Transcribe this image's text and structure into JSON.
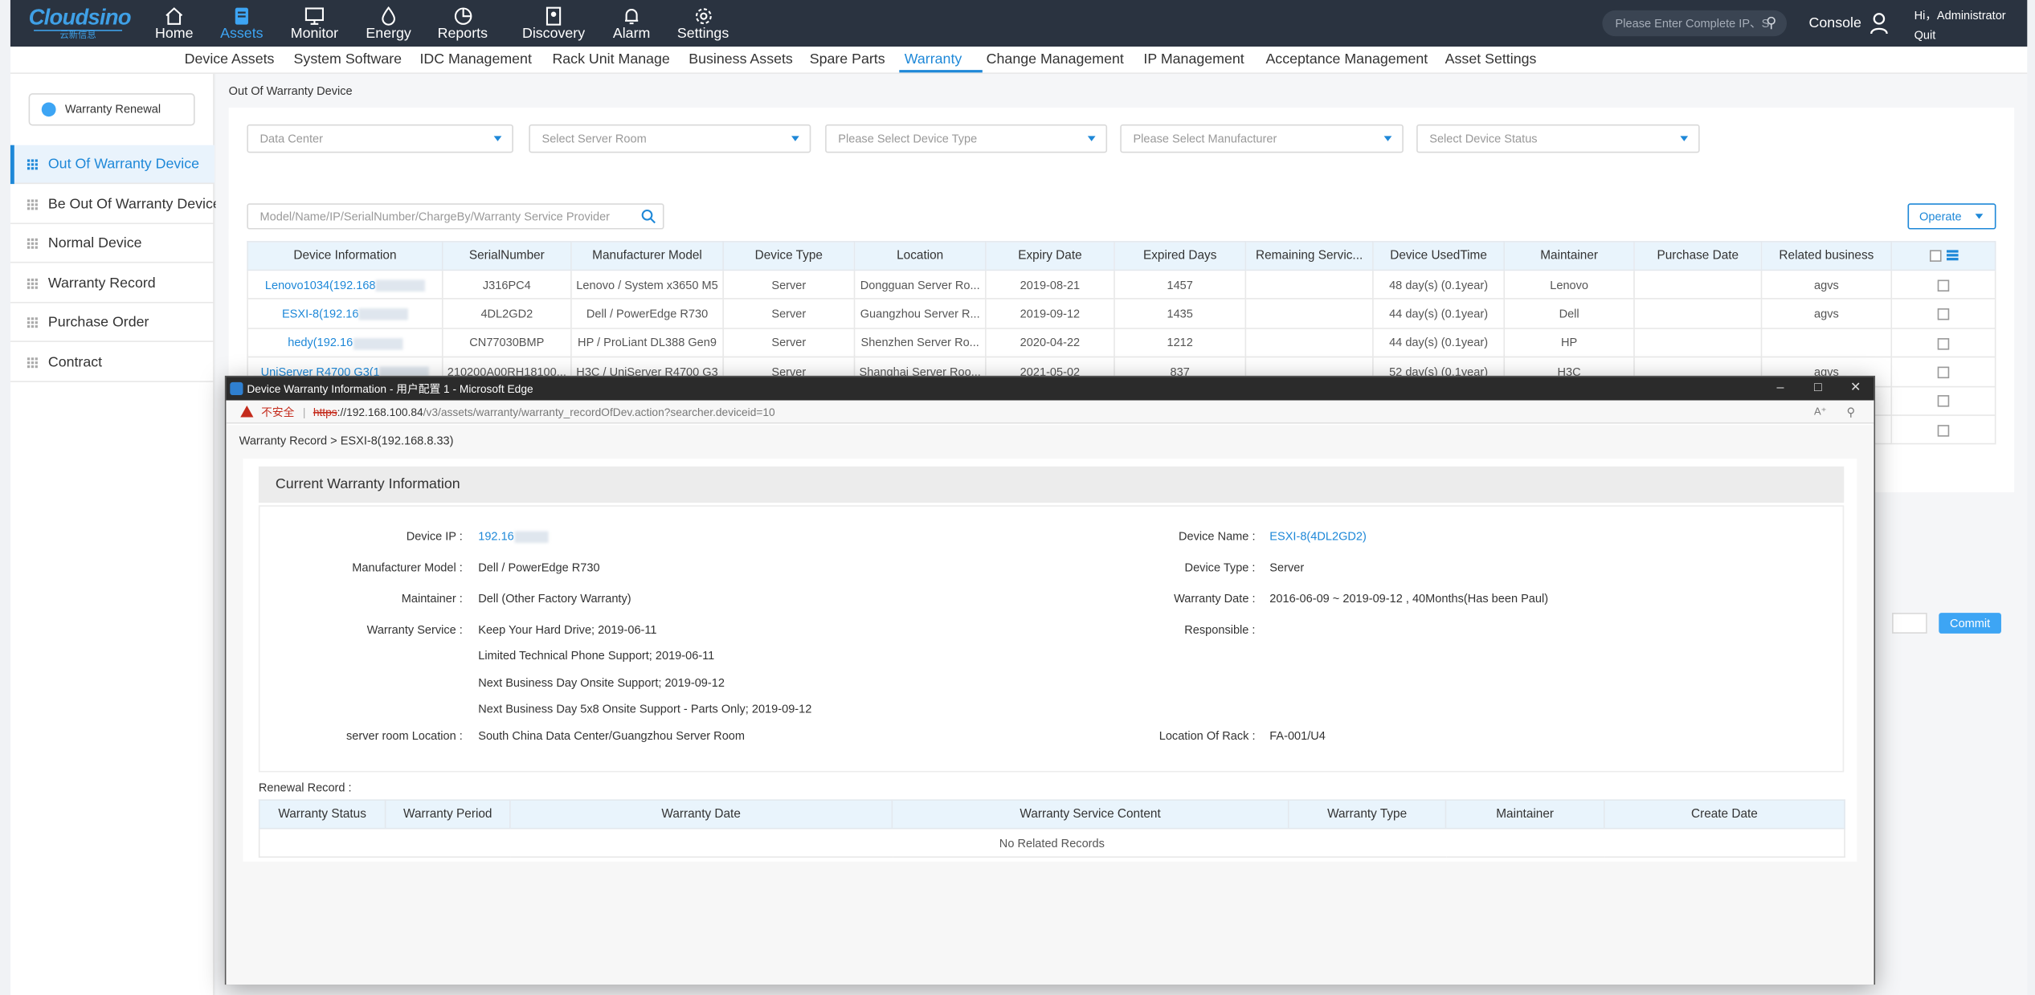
{
  "top": {
    "logo": "Cloudsino",
    "logo_sub": "云新信息",
    "nav": [
      {
        "label": "Home",
        "icon": "home-icon"
      },
      {
        "label": "Assets",
        "icon": "assets-icon"
      },
      {
        "label": "Monitor",
        "icon": "monitor-icon"
      },
      {
        "label": "Energy",
        "icon": "energy-icon"
      },
      {
        "label": "Reports",
        "icon": "reports-icon"
      },
      {
        "label": "Discovery",
        "icon": "discovery-icon"
      },
      {
        "label": "Alarm",
        "icon": "bell-icon"
      },
      {
        "label": "Settings",
        "icon": "gear-icon"
      }
    ],
    "search_placeholder": "Please Enter Complete IP、S",
    "console": "Console",
    "hi": "Hi，Administrator",
    "quit": "Quit",
    "accent": "#3da5f4"
  },
  "subnav": [
    "Device Assets",
    "System Software",
    "IDC Management",
    "Rack Unit Manage",
    "Business Assets",
    "Spare Parts",
    "Warranty",
    "Change Management",
    "IP Management",
    "Acceptance Management",
    "Asset Settings"
  ],
  "sidebar": {
    "renew_button": "Warranty Renewal",
    "items": [
      "Out Of Warranty Device",
      "Be Out Of Warranty Device",
      "Normal Device",
      "Warranty Record",
      "Purchase Order",
      "Contract"
    ]
  },
  "content": {
    "title": "Out Of Warranty Device",
    "filters": [
      "Data Center",
      "Select Server Room",
      "Please Select Device Type",
      "Please Select Manufacturer",
      "Select Device Status"
    ],
    "keyword_placeholder": "Model/Name/IP/SerialNumber/ChargeBy/Warranty Service Provider",
    "operate": "Operate",
    "commit": "Commit",
    "columns": [
      "Device Information",
      "SerialNumber",
      "Manufacturer Model",
      "Device Type",
      "Location",
      "Expiry Date",
      "Expired Days",
      "Remaining Servic...",
      "Device UsedTime",
      "Maintainer",
      "Purchase Date",
      "Related business"
    ],
    "rows": [
      [
        "Lenovo1034(192.168",
        "J316PC4",
        "Lenovo / System x3650 M5",
        "Server",
        "Dongguan Server Ro...",
        "2019-08-21",
        "1457",
        "",
        "48 day(s) (0.1year)",
        "Lenovo",
        "",
        "agvs"
      ],
      [
        "ESXI-8(192.16",
        "4DL2GD2",
        "Dell / PowerEdge R730",
        "Server",
        "Guangzhou Server R...",
        "2019-09-12",
        "1435",
        "",
        "44 day(s) (0.1year)",
        "Dell",
        "",
        "agvs"
      ],
      [
        "hedy(192.16",
        "CN77030BMP",
        "HP / ProLiant DL388 Gen9",
        "Server",
        "Shenzhen Server Ro...",
        "2020-04-22",
        "1212",
        "",
        "44 day(s) (0.1year)",
        "HP",
        "",
        ""
      ],
      [
        "UniServer R4700 G3(1",
        "210200A00RH18100...",
        "H3C / UniServer R4700 G3",
        "Server",
        "Shanghai Server Roo...",
        "2021-05-02",
        "837",
        "",
        "52 day(s) (0.1year)",
        "H3C",
        "",
        "agvs"
      ]
    ]
  },
  "popup": {
    "window_title": "Device Warranty Information - 用户配置 1 - Microsoft Edge",
    "insecure": "不安全",
    "url_https": "https",
    "url_host": "://192.168.100.84",
    "url_path": "/v3/assets/warranty/warranty_recordOfDev.action?searcher.deviceid=10",
    "breadcrumb": "Warranty Record >  ESXI-8(192.168.8.33)",
    "section_title": "Current Warranty Information",
    "fields": {
      "device_ip_label": "Device IP :",
      "device_ip": "192.16",
      "device_name_label": "Device Name :",
      "device_name": "ESXI-8(4DL2GD2)",
      "model_label": "Manufacturer Model :",
      "model": "Dell / PowerEdge R730",
      "type_label": "Device Type :",
      "type": "Server",
      "maintainer_label": "Maintainer :",
      "maintainer": "Dell (Other Factory Warranty)",
      "date_label": "Warranty Date :",
      "date": "2016-06-09 ~ 2019-09-12 , 40Months(Has been Paul)",
      "service_label": "Warranty Service :",
      "services": [
        "Keep Your Hard Drive; 2019-06-11",
        "Limited Technical Phone Support; 2019-06-11",
        "Next Business Day Onsite Support; 2019-09-12",
        "Next Business Day 5x8 Onsite Support - Parts Only; 2019-09-12"
      ],
      "responsible_label": "Responsible :",
      "room_label": "server room Location :",
      "room": "South China Data Center/Guangzhou Server Room",
      "rack_label": "Location Of Rack :",
      "rack": "FA-001/U4"
    },
    "renewal_label": "Renewal Record :",
    "renewal_columns": [
      "Warranty Status",
      "Warranty Period",
      "Warranty Date",
      "Warranty Service Content",
      "Warranty Type",
      "Maintainer",
      "Create Date"
    ],
    "no_records": "No Related Records"
  }
}
